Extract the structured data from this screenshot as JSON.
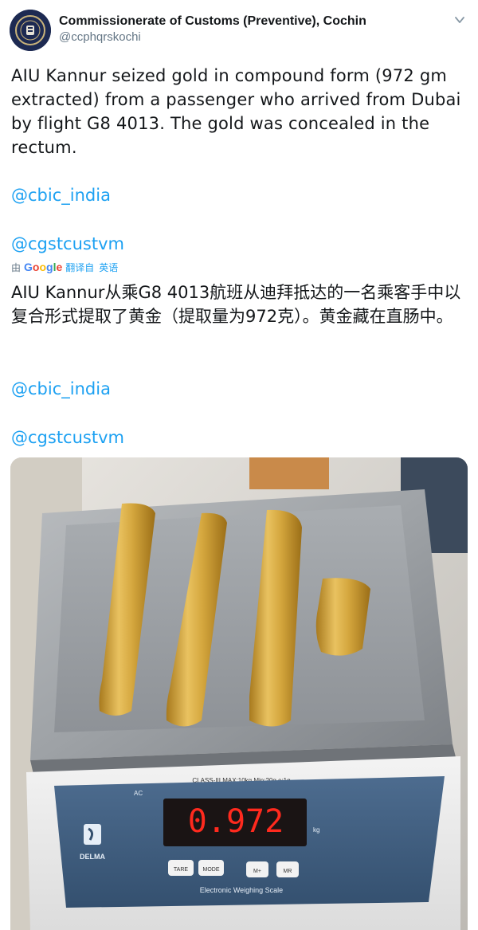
{
  "account": {
    "display_name": "Commissionerate of Customs (Preventive), Cochin",
    "handle": "@ccphqrskochi"
  },
  "tweet": {
    "text": "AIU Kannur seized gold in compound form (972 gm extracted) from a passenger who arrived from Dubai by flight G8 4013. The gold was concealed in the rectum.",
    "mentions": [
      "@cbic_india",
      "@cgstcustvm"
    ]
  },
  "translation": {
    "prefix": "由",
    "google": [
      "G",
      "o",
      "o",
      "g",
      "l",
      "e"
    ],
    "link_label": "翻译自",
    "source_language": "英语",
    "text": "AIU Kannur从乘G8 4013航班从迪拜抵达的一名乘客手中以复合形式提取了黄金（提取量为972克）。黄金藏在直肠中。",
    "mentions": [
      "@cbic_india",
      "@cgstcustvm"
    ]
  },
  "photo": {
    "scale_class_label": "CLASS-III MAX:10kg Min:20g e:1g",
    "scale_display": "0.972",
    "scale_unit": "kg",
    "ac_label": "AC",
    "brand": "DELMA",
    "buttons": [
      "TARE",
      "MODE",
      "M+",
      "MR"
    ],
    "scale_caption": "Electronic Weighing Scale"
  },
  "colors": {
    "accent": "#1da1f2",
    "text": "#14171a",
    "muted": "#657786",
    "gold": "#d8a93a",
    "display_red": "#ff2a1e"
  }
}
